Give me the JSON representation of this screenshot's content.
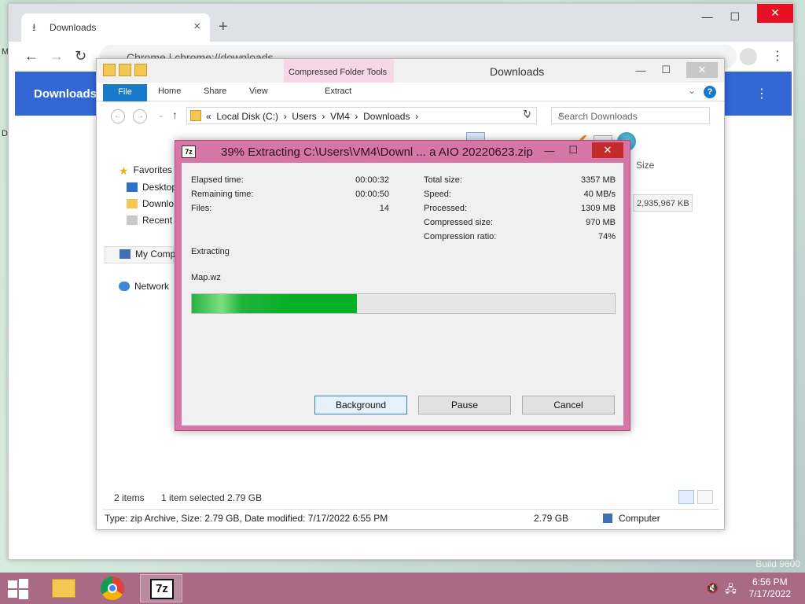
{
  "desktop": {
    "fragments": [
      "M",
      "D"
    ],
    "watermark": "Build 9600"
  },
  "chrome": {
    "tab_title": "Downloads",
    "omnibox_text": "Chrome  |  chrome://downloads",
    "header_title": "Downloads"
  },
  "explorer": {
    "window_title": "Downloads",
    "contextual_tab_group": "Compressed Folder Tools",
    "ribbon_tabs": {
      "file": "File",
      "home": "Home",
      "share": "Share",
      "view": "View",
      "extract": "Extract"
    },
    "breadcrumb": [
      "«",
      "Local Disk (C:)",
      "Users",
      "VM4",
      "Downloads"
    ],
    "search_placeholder": "Search Downloads",
    "nav": {
      "favorites": "Favorites",
      "desktop": "Desktop",
      "downloads": "Downlo",
      "recent": "Recent p",
      "computer": "My Comp",
      "network": "Network"
    },
    "column_size": "Size",
    "size_value": "2,935,967 KB",
    "status": {
      "items": "2 items",
      "selected": "1 item selected  2.79 GB"
    },
    "details": {
      "summary": "Type: zip Archive, Size: 2.79 GB, Date modified: 7/17/2022 6:55 PM",
      "size": "2.79 GB",
      "location": "Computer"
    }
  },
  "dialog": {
    "logo": "7z",
    "title": "39% Extracting C:\\Users\\VM4\\Downl ... a AIO 20220623.zip",
    "progress": 0.39,
    "left_stats": [
      {
        "label": "Elapsed time:",
        "value": "00:00:32"
      },
      {
        "label": "Remaining time:",
        "value": "00:00:50"
      },
      {
        "label": "Files:",
        "value": "14"
      }
    ],
    "right_stats": [
      {
        "label": "Total size:",
        "value": "3357 MB"
      },
      {
        "label": "Speed:",
        "value": "40 MB/s"
      },
      {
        "label": "Processed:",
        "value": "1309 MB"
      },
      {
        "label": "Compressed size:",
        "value": "970 MB"
      },
      {
        "label": "Compression ratio:",
        "value": "74%"
      }
    ],
    "status_label": "Extracting",
    "current_file": "Map.wz",
    "buttons": {
      "background": "Background",
      "pause": "Pause",
      "cancel": "Cancel"
    }
  },
  "taskbar": {
    "time": "6:56 PM",
    "date": "7/17/2022",
    "sevenzip_label": "7z"
  }
}
